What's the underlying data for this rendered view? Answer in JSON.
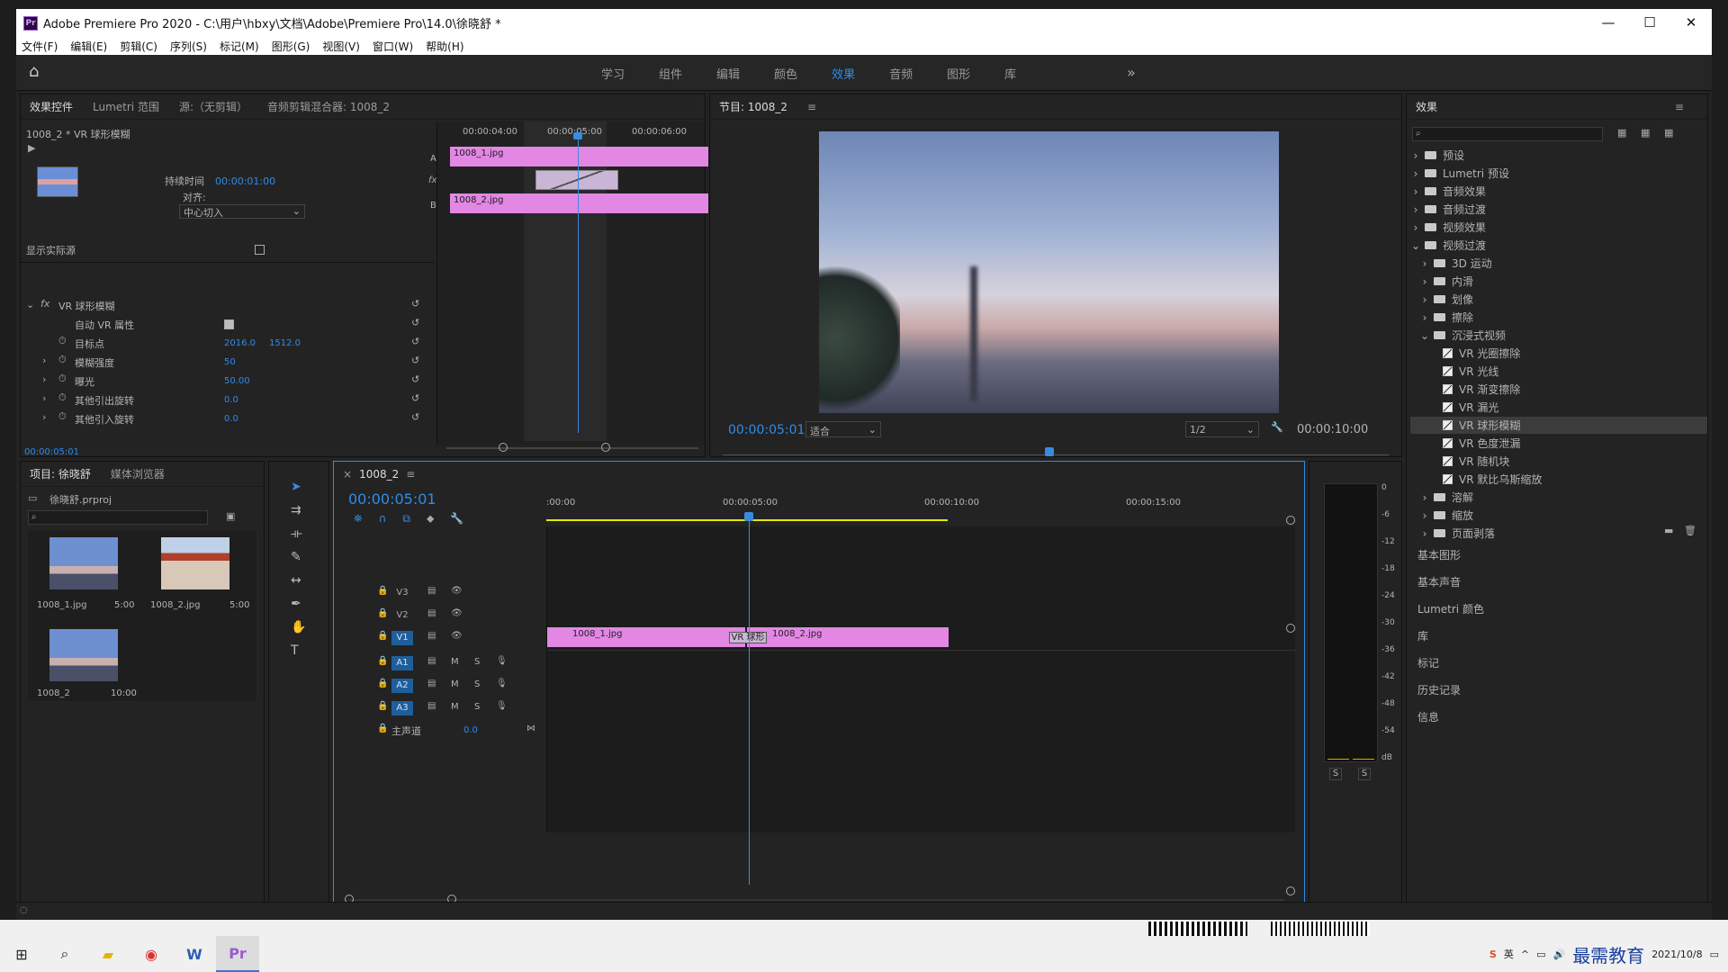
{
  "window": {
    "title": "Adobe Premiere Pro 2020 - C:\\用户\\hbxy\\文档\\Adobe\\Premiere Pro\\14.0\\徐晓舒 *",
    "app_badge": "Pr",
    "minimize": "—",
    "maximize": "☐",
    "close": "✕"
  },
  "menu": [
    "文件(F)",
    "编辑(E)",
    "剪辑(C)",
    "序列(S)",
    "标记(M)",
    "图形(G)",
    "视图(V)",
    "窗口(W)",
    "帮助(H)"
  ],
  "workspaces": {
    "items": [
      "学习",
      "组件",
      "编辑",
      "颜色",
      "效果",
      "音频",
      "图形",
      "库"
    ],
    "active": "效果",
    "more": "»"
  },
  "effect_controls": {
    "tabs": [
      "效果控件",
      "Lumetri 范围",
      "源:（无剪辑）",
      "音频剪辑混合器: 1008_2"
    ],
    "clip_label": "1008_2 * VR 球形模糊",
    "duration_label": "持续时间",
    "duration_value": "00:00:01:00",
    "align_label": "对齐:",
    "align_value": "中心切入",
    "show_source": "显示实际源",
    "ruler": [
      "00:00:04:00",
      "00:00:05:00",
      "00:00:06:00"
    ],
    "clip_a": "1008_1.jpg",
    "clip_b": "1008_2.jpg",
    "track_a": "A",
    "track_b": "B",
    "fx_label": "fx",
    "effect_name": "VR 球形模糊",
    "props": [
      {
        "name": "自动 VR 属性",
        "value": ""
      },
      {
        "name": "目标点",
        "value": "2016.0",
        "value2": "1512.0"
      },
      {
        "name": "模糊强度",
        "value": "50"
      },
      {
        "name": "曝光",
        "value": "50.00"
      },
      {
        "name": "其他引出旋转",
        "value": "0.0"
      },
      {
        "name": "其他引入旋转",
        "value": "0.0"
      }
    ],
    "current_time": "00:00:05:01"
  },
  "program": {
    "title": "节目: 1008_2",
    "timecode": "00:00:05:01",
    "fit": "适合",
    "resolution": "1/2",
    "duration": "00:00:10:00"
  },
  "effects": {
    "title": "效果",
    "tree": [
      {
        "label": "预设",
        "level": 0,
        "type": "folder",
        "exp": "›"
      },
      {
        "label": "Lumetri 预设",
        "level": 0,
        "type": "folder",
        "exp": "›"
      },
      {
        "label": "音频效果",
        "level": 0,
        "type": "folder",
        "exp": "›"
      },
      {
        "label": "音频过渡",
        "level": 0,
        "type": "folder",
        "exp": "›"
      },
      {
        "label": "视频效果",
        "level": 0,
        "type": "folder",
        "exp": "›"
      },
      {
        "label": "视频过渡",
        "level": 0,
        "type": "folder",
        "exp": "⌄"
      },
      {
        "label": "3D 运动",
        "level": 1,
        "type": "folder",
        "exp": "›"
      },
      {
        "label": "内滑",
        "level": 1,
        "type": "folder",
        "exp": "›"
      },
      {
        "label": "划像",
        "level": 1,
        "type": "folder",
        "exp": "›"
      },
      {
        "label": "擦除",
        "level": 1,
        "type": "folder",
        "exp": "›"
      },
      {
        "label": "沉浸式视频",
        "level": 1,
        "type": "folder",
        "exp": "⌄"
      },
      {
        "label": "VR 光圈擦除",
        "level": 2,
        "type": "fx",
        "exp": ""
      },
      {
        "label": "VR 光线",
        "level": 2,
        "type": "fx",
        "exp": ""
      },
      {
        "label": "VR 渐变擦除",
        "level": 2,
        "type": "fx",
        "exp": ""
      },
      {
        "label": "VR 漏光",
        "level": 2,
        "type": "fx",
        "exp": ""
      },
      {
        "label": "VR 球形模糊",
        "level": 2,
        "type": "fx",
        "exp": "",
        "selected": true
      },
      {
        "label": "VR 色度泄漏",
        "level": 2,
        "type": "fx",
        "exp": ""
      },
      {
        "label": "VR 随机块",
        "level": 2,
        "type": "fx",
        "exp": ""
      },
      {
        "label": "VR 默比乌斯缩放",
        "level": 2,
        "type": "fx",
        "exp": ""
      },
      {
        "label": "溶解",
        "level": 1,
        "type": "folder",
        "exp": "›"
      },
      {
        "label": "缩放",
        "level": 1,
        "type": "folder",
        "exp": "›"
      },
      {
        "label": "页面剥落",
        "level": 1,
        "type": "folder",
        "exp": "›"
      }
    ],
    "side_panels": [
      "基本图形",
      "基本声音",
      "Lumetri 颜色",
      "库",
      "标记",
      "历史记录",
      "信息"
    ]
  },
  "project": {
    "tabs": [
      "项目: 徐晓舒",
      "媒体浏览器"
    ],
    "file": "徐晓舒.prproj",
    "items": [
      {
        "name": "1008_1.jpg",
        "dur": "5:00"
      },
      {
        "name": "1008_2.jpg",
        "dur": "5:00"
      },
      {
        "name": "1008_2",
        "dur": "10:00"
      }
    ]
  },
  "timeline": {
    "tab": "1008_2",
    "timecode": "00:00:05:01",
    "ruler": [
      ":00:00",
      "00:00:05:00",
      "00:00:10:00",
      "00:00:15:00"
    ],
    "video_tracks": [
      "V3",
      "V2",
      "V1"
    ],
    "audio_tracks": [
      "A1",
      "A2",
      "A3"
    ],
    "mute": "M",
    "solo": "S",
    "master": "主声道",
    "master_value": "0.0",
    "clip1": "1008_1.jpg",
    "clip2": "1008_2.jpg",
    "transition": "VR 球形"
  },
  "meter": {
    "scale": [
      "0",
      "-6",
      "-12",
      "-18",
      "-24",
      "-30",
      "-36",
      "-42",
      "-48",
      "-54",
      "dB"
    ],
    "solo": "S"
  },
  "taskbar": {
    "ime": "英",
    "date": "2021/10/8",
    "watermark": "最需教育"
  }
}
